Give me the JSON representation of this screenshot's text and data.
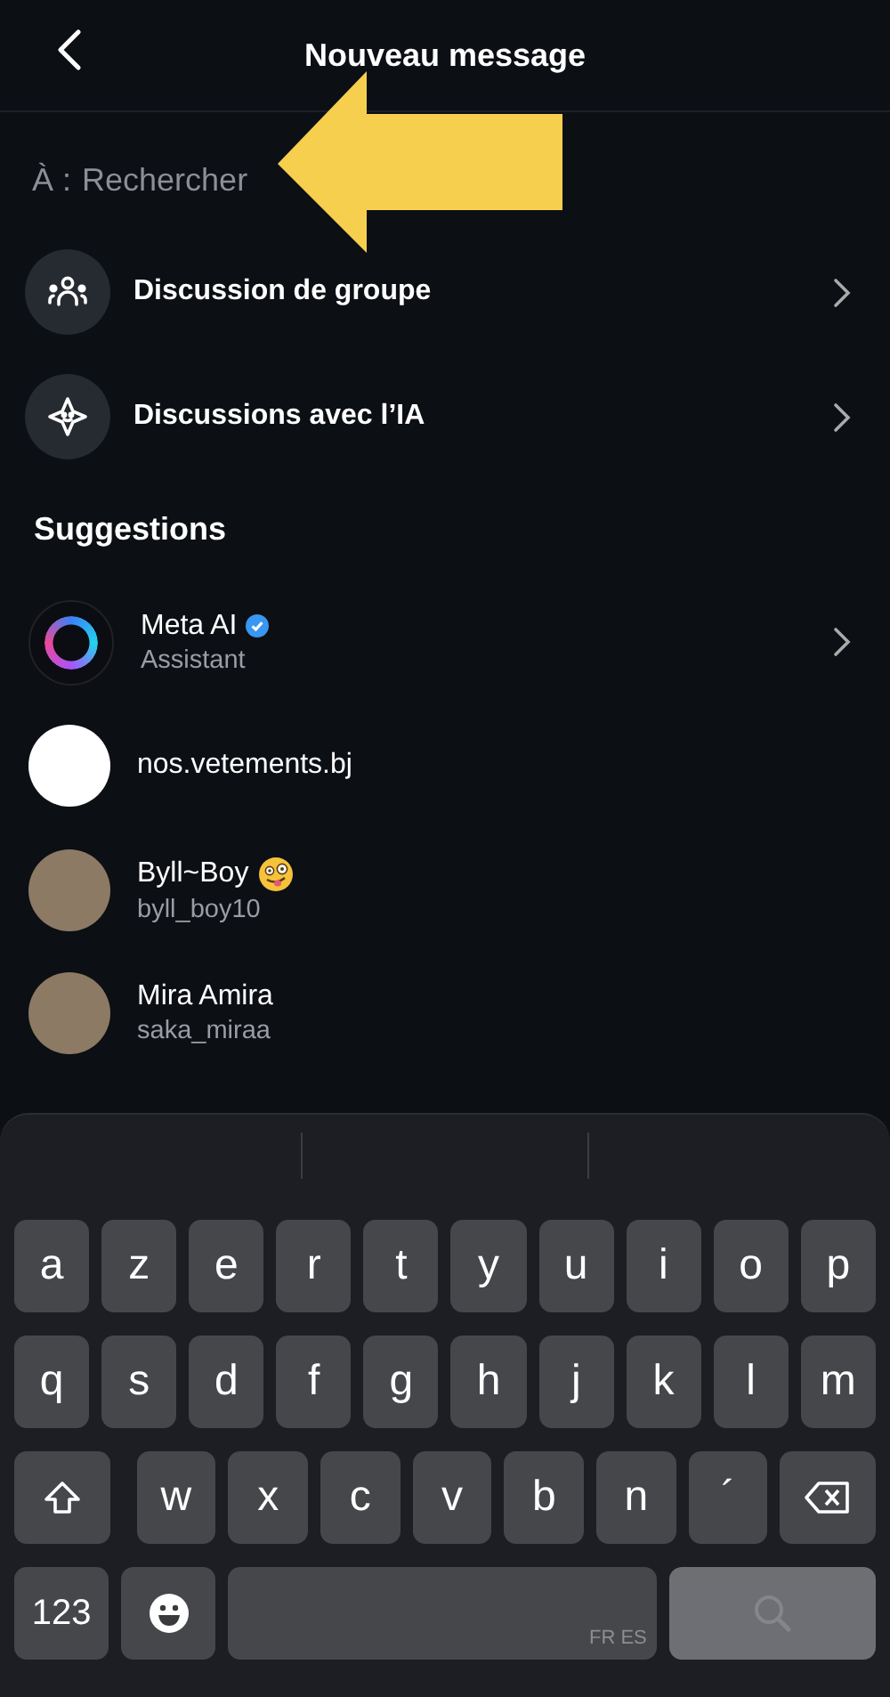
{
  "header": {
    "title": "Nouveau message"
  },
  "search": {
    "label": "À :",
    "placeholder": "Rechercher"
  },
  "annotation": {
    "kind": "arrow"
  },
  "actions": [
    {
      "kind": "group",
      "label": "Discussion de groupe"
    },
    {
      "kind": "ai",
      "label": "Discussions avec l’IA"
    }
  ],
  "suggestions_title": "Suggestions",
  "contacts": [
    {
      "kind": "ring",
      "name": "Meta AI",
      "verified": true,
      "subtitle": "Assistant",
      "chevron": true,
      "emoji": false
    },
    {
      "kind": "logo",
      "name": "nos.vetements.bj",
      "verified": false,
      "chevron": false,
      "emoji": false
    },
    {
      "kind": "photo",
      "name": "Byll~Boy",
      "verified": false,
      "subtitle": "byll_boy10",
      "chevron": false,
      "emoji": true
    },
    {
      "kind": "photo",
      "name": "Mira Amira",
      "verified": false,
      "subtitle": "saka_miraa",
      "chevron": false,
      "emoji": false
    }
  ],
  "keyboard": {
    "rows": [
      [
        {
          "kind": "char",
          "label": "a"
        },
        {
          "kind": "char",
          "label": "z"
        },
        {
          "kind": "char",
          "label": "e"
        },
        {
          "kind": "char",
          "label": "r"
        },
        {
          "kind": "char",
          "label": "t"
        },
        {
          "kind": "char",
          "label": "y"
        },
        {
          "kind": "char",
          "label": "u"
        },
        {
          "kind": "char",
          "label": "i"
        },
        {
          "kind": "char",
          "label": "o"
        },
        {
          "kind": "char",
          "label": "p"
        }
      ],
      [
        {
          "kind": "char",
          "label": "q"
        },
        {
          "kind": "char",
          "label": "s"
        },
        {
          "kind": "char",
          "label": "d"
        },
        {
          "kind": "char",
          "label": "f"
        },
        {
          "kind": "char",
          "label": "g"
        },
        {
          "kind": "char",
          "label": "h"
        },
        {
          "kind": "char",
          "label": "j"
        },
        {
          "kind": "char",
          "label": "k"
        },
        {
          "kind": "char",
          "label": "l"
        },
        {
          "kind": "char",
          "label": "m"
        }
      ],
      [
        {
          "kind": "shift"
        },
        {
          "kind": "char",
          "label": "w"
        },
        {
          "kind": "char",
          "label": "x"
        },
        {
          "kind": "char",
          "label": "c"
        },
        {
          "kind": "char",
          "label": "v"
        },
        {
          "kind": "char",
          "label": "b"
        },
        {
          "kind": "char",
          "label": "n"
        },
        {
          "kind": "char",
          "label": "´"
        },
        {
          "kind": "delete"
        }
      ],
      [
        {
          "kind": "numbers",
          "label": "123"
        },
        {
          "kind": "emoji"
        },
        {
          "kind": "space",
          "label": "FR ES"
        },
        {
          "kind": "search",
          "disabled": true
        }
      ]
    ]
  }
}
